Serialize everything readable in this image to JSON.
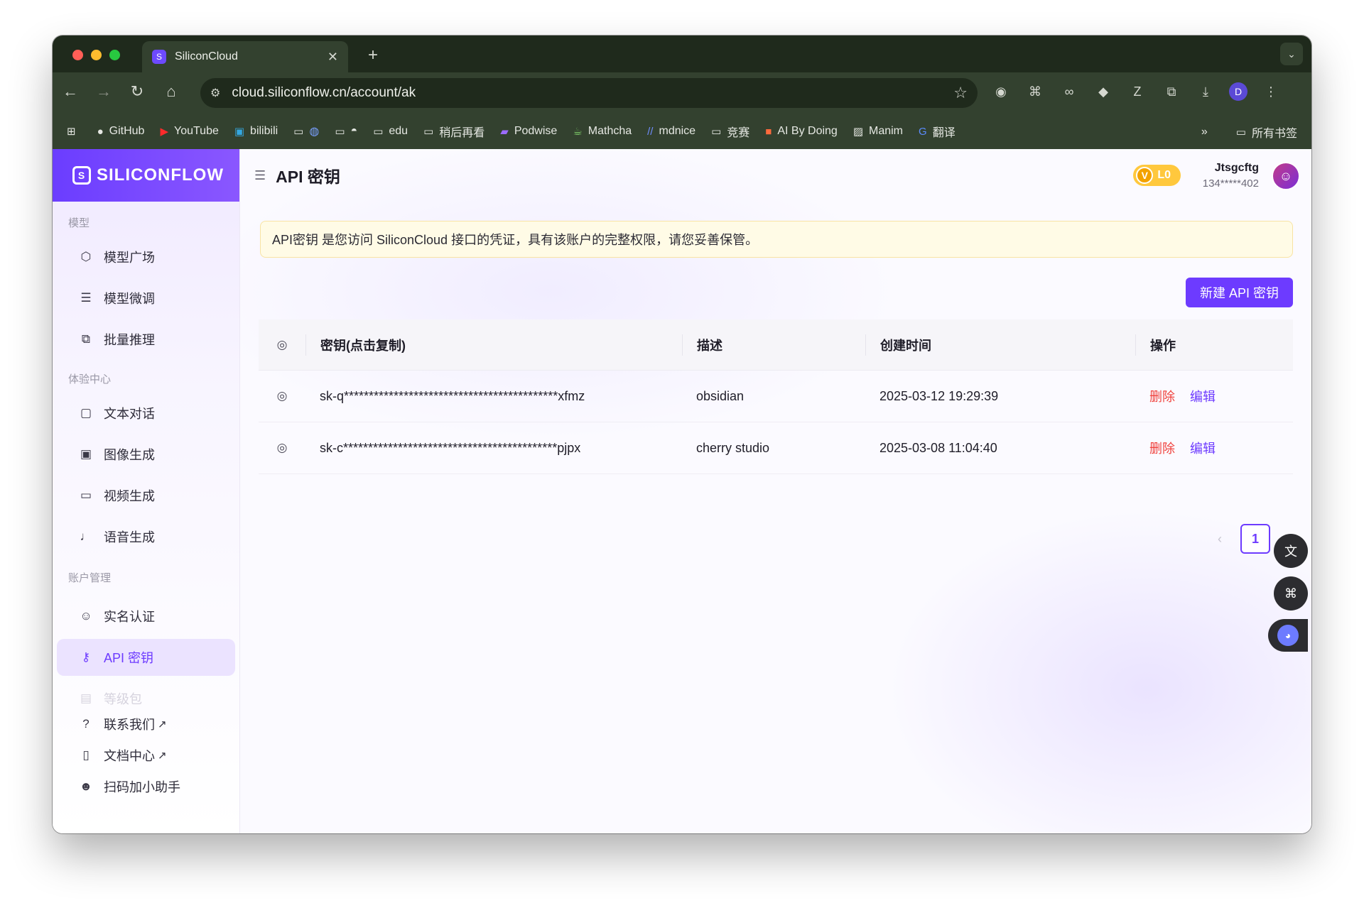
{
  "browser": {
    "tab_title": "SiliconCloud",
    "url": "cloud.siliconflow.cn/account/ak",
    "bookmarks": [
      {
        "label": "GitHub",
        "icon": "github-icon"
      },
      {
        "label": "YouTube",
        "icon": "youtube-icon"
      },
      {
        "label": "bilibili",
        "icon": "bilibili-icon"
      },
      {
        "label": "",
        "icon": "folder-icon"
      },
      {
        "label": "",
        "icon": "folder-icon"
      },
      {
        "label": "edu",
        "icon": "folder-icon"
      },
      {
        "label": "稍后再看",
        "icon": "folder-icon"
      },
      {
        "label": "Podwise",
        "icon": "podwise-icon"
      },
      {
        "label": "Mathcha",
        "icon": "mathcha-icon"
      },
      {
        "label": "mdnice",
        "icon": "mdnice-icon"
      },
      {
        "label": "竞赛",
        "icon": "folder-icon"
      },
      {
        "label": "AI By Doing",
        "icon": "aibydoing-icon"
      },
      {
        "label": "Manim",
        "icon": "manim-icon"
      },
      {
        "label": "翻译",
        "icon": "translate-icon"
      }
    ],
    "all_bookmarks": "所有书签",
    "profile_initial": "D"
  },
  "brand": {
    "name": "SILICONFLOW"
  },
  "sidebar": {
    "sections": [
      {
        "title": "模型",
        "items": [
          {
            "label": "模型广场",
            "icon": "cube-icon"
          },
          {
            "label": "模型微调",
            "icon": "sliders-icon"
          },
          {
            "label": "批量推理",
            "icon": "copy-icon"
          }
        ]
      },
      {
        "title": "体验中心",
        "items": [
          {
            "label": "文本对话",
            "icon": "chat-icon"
          },
          {
            "label": "图像生成",
            "icon": "image-icon"
          },
          {
            "label": "视频生成",
            "icon": "video-icon"
          },
          {
            "label": "语音生成",
            "icon": "mic-icon"
          }
        ]
      },
      {
        "title": "账户管理",
        "items": [
          {
            "label": "实名认证",
            "icon": "user-check-icon"
          },
          {
            "label": "API 密钥",
            "icon": "key-icon",
            "active": true
          },
          {
            "label": "等级包",
            "icon": "package-icon"
          }
        ]
      }
    ],
    "footer": [
      {
        "label": "联系我们",
        "icon": "help-icon"
      },
      {
        "label": "文档中心",
        "icon": "book-icon"
      },
      {
        "label": "扫码加小助手",
        "icon": "users-icon"
      }
    ]
  },
  "header": {
    "title": "API 密钥",
    "level": "L0",
    "user_name": "Jtsgcftg",
    "user_phone": "134*****402"
  },
  "notice": "API密钥 是您访问 SiliconCloud 接口的凭证，具有该账户的完整权限，请您妥善保管。",
  "new_key_button": "新建 API 密钥",
  "table": {
    "columns": [
      "密钥(点击复制)",
      "描述",
      "创建时间",
      "操作"
    ],
    "rows": [
      {
        "key": "sk-q*******************************************xfmz",
        "desc": "obsidian",
        "time": "2025-03-12 19:29:39",
        "delete": "删除",
        "edit": "编辑"
      },
      {
        "key": "sk-c*******************************************pjpx",
        "desc": "cherry studio",
        "time": "2025-03-08 11:04:40",
        "delete": "删除",
        "edit": "编辑"
      }
    ]
  },
  "pagination": {
    "current": "1"
  }
}
